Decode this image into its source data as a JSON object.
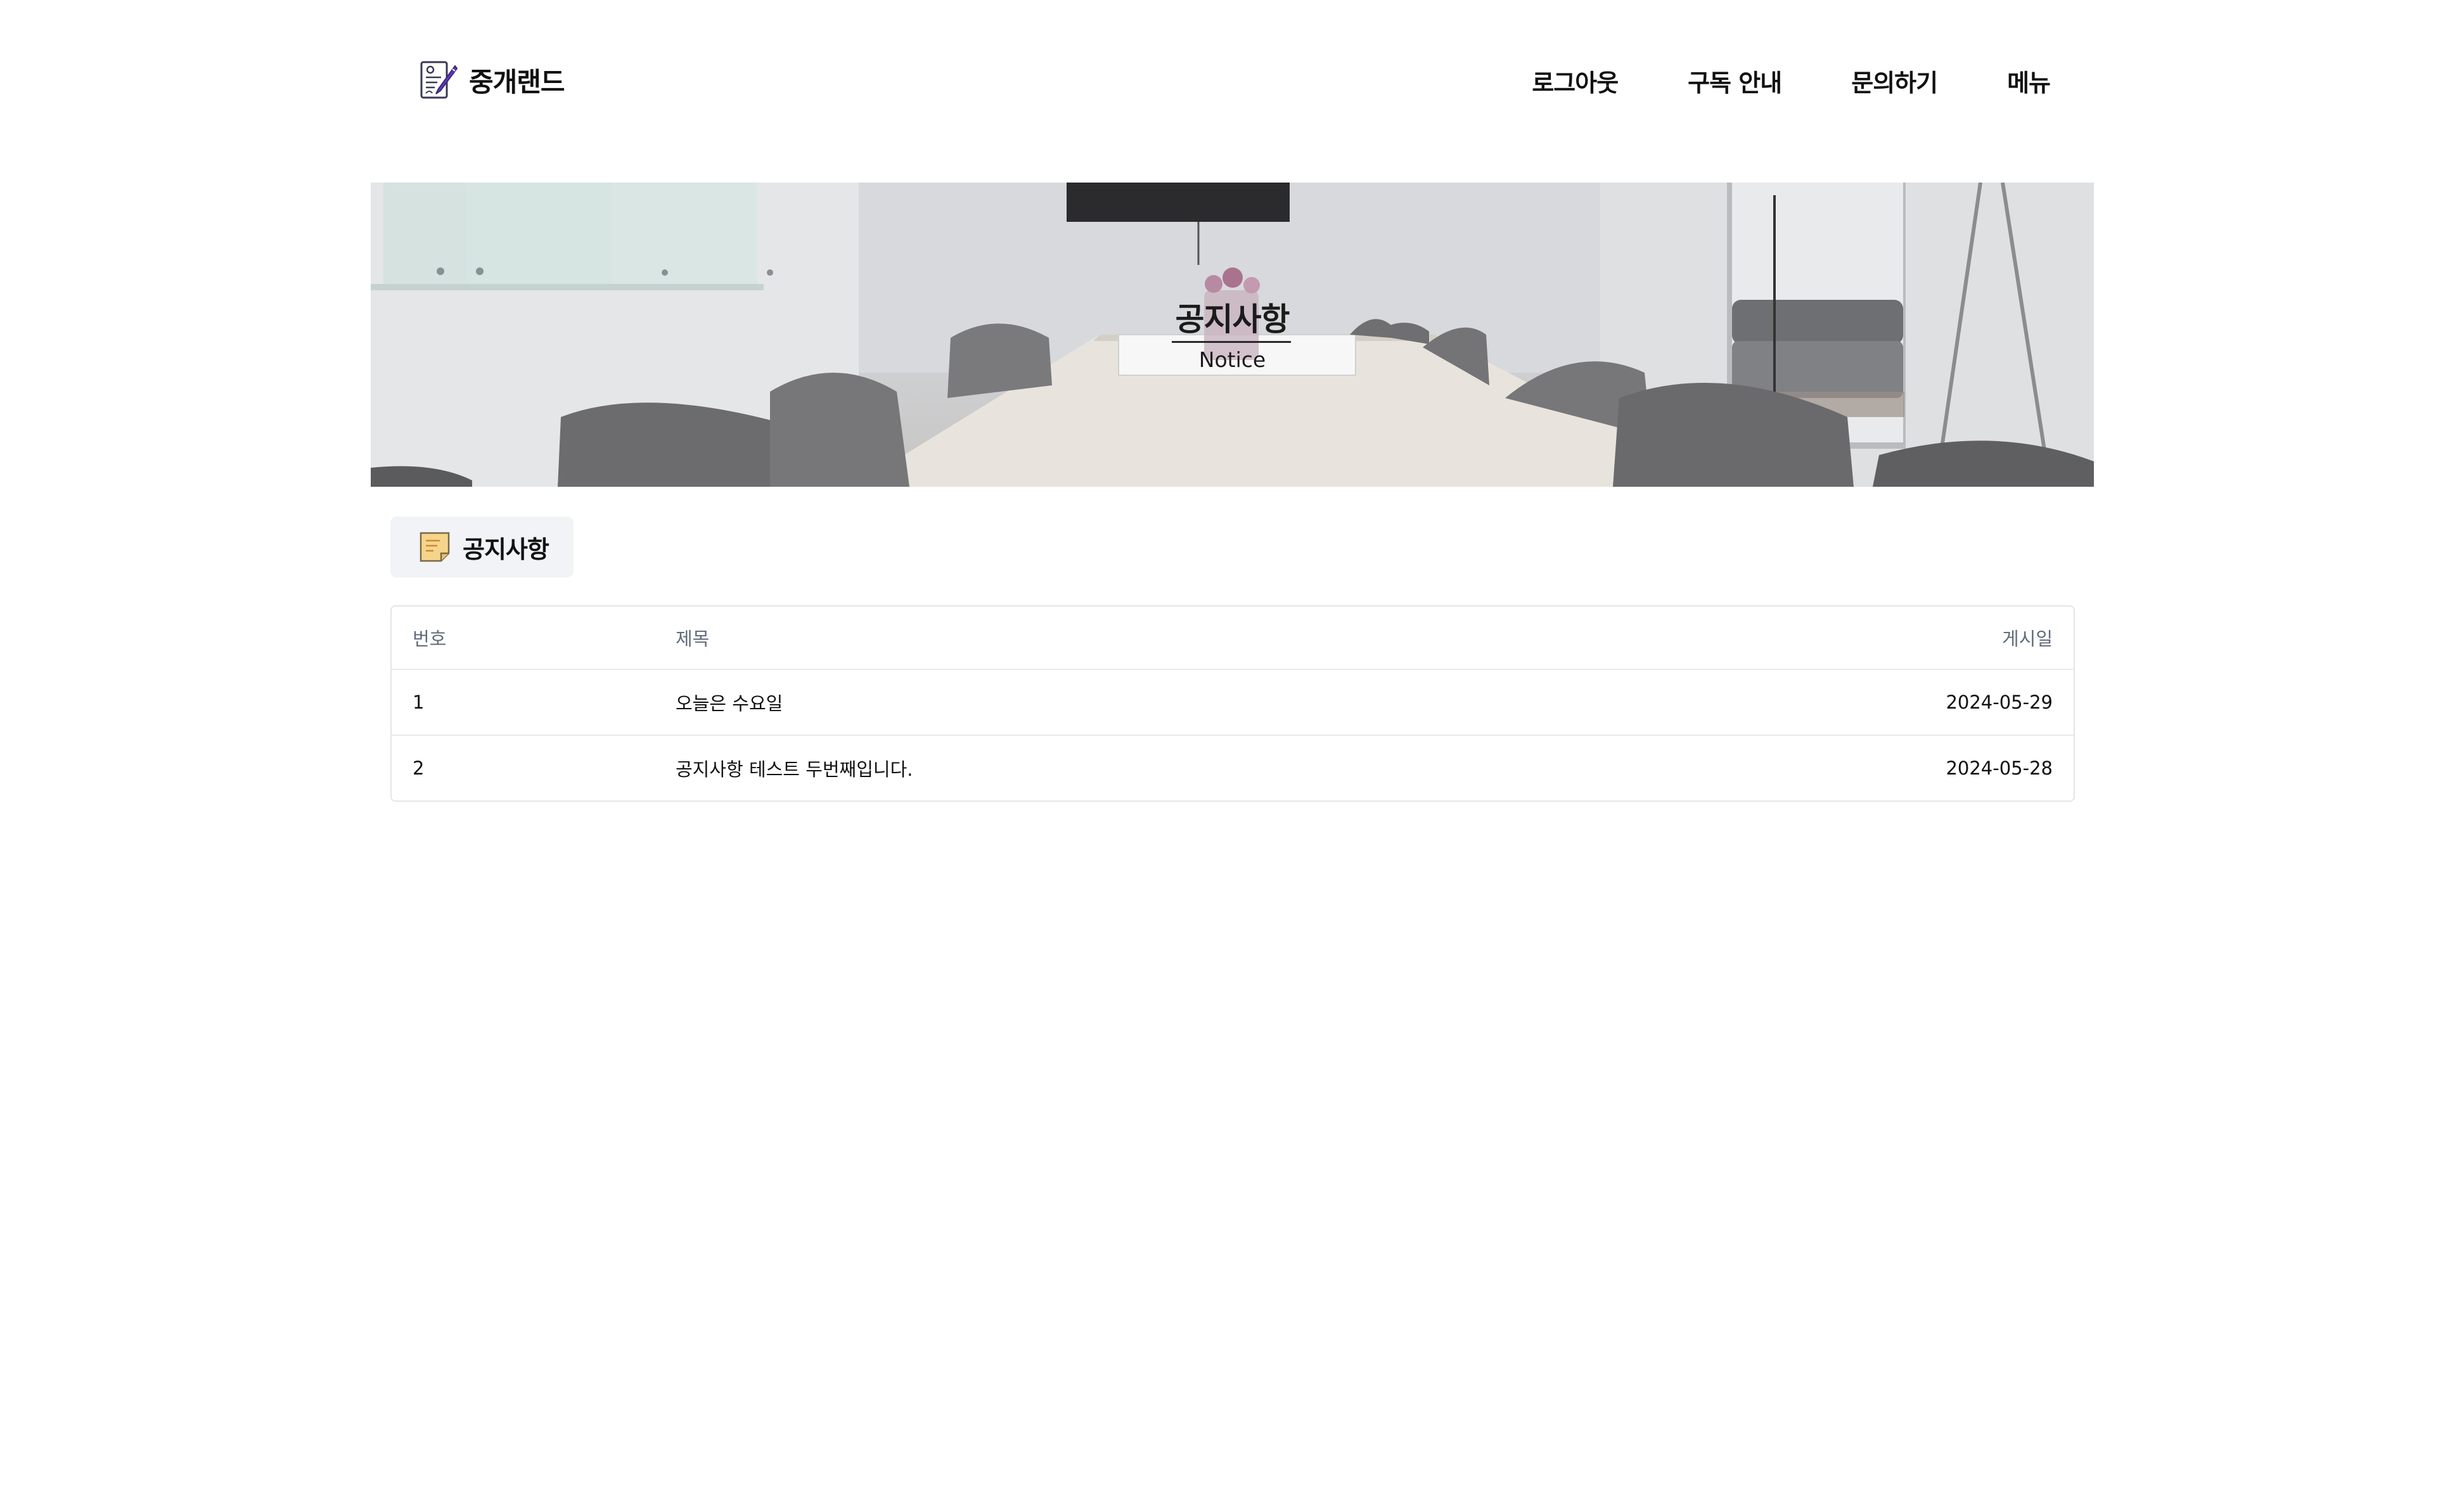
{
  "header": {
    "logo_text": "중개랜드",
    "logo_icon": "contract-pen-icon",
    "nav": [
      {
        "label": "로그아웃"
      },
      {
        "label": "구독 안내"
      },
      {
        "label": "문의하기"
      },
      {
        "label": "메뉴"
      }
    ]
  },
  "hero": {
    "title": "공지사항",
    "subtitle": "Notice"
  },
  "section_tab": {
    "label": "공지사항",
    "icon": "memo-icon"
  },
  "table": {
    "columns": [
      "번호",
      "제목",
      "게시일"
    ],
    "rows": [
      {
        "no": "1",
        "title": "오늘은 수요일",
        "date": "2024-05-29"
      },
      {
        "no": "2",
        "title": "공지사항 테스트 두번째입니다.",
        "date": "2024-05-28"
      }
    ]
  },
  "colors": {
    "logo_pen": "#6a35c9",
    "tab_background": "#f1f3f6",
    "table_border": "#e3e5e8",
    "header_text": "#5f6b7a",
    "memo_icon": "#f6d58a"
  }
}
